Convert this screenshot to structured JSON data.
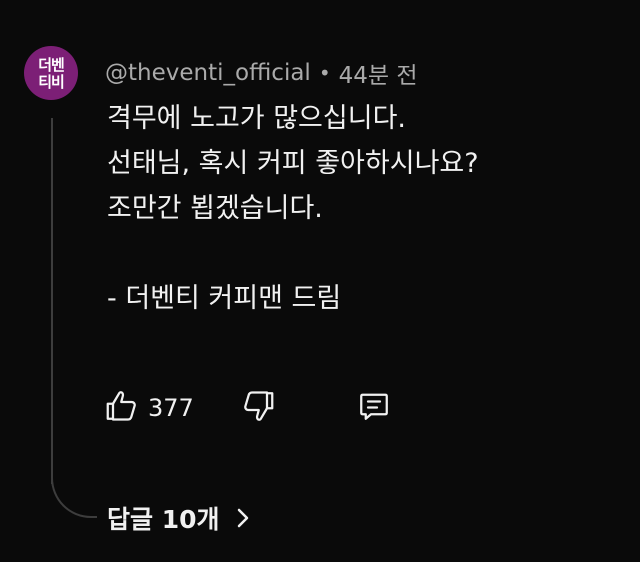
{
  "avatar": {
    "line1": "더벤",
    "line2": "티비",
    "bg_color": "#7c1f76"
  },
  "comment": {
    "username": "@theventi_official",
    "separator": "•",
    "time_ago": "44분 전",
    "lines": [
      "격무에 노고가 많으십니다.",
      "선태님, 혹시 커피 좋아하시나요?",
      "조만간 뵙겠습니다.",
      "",
      "- 더벤티 커피맨 드림"
    ]
  },
  "actions": {
    "like_icon": "thumbs-up-icon",
    "like_count": "377",
    "dislike_icon": "thumbs-down-icon",
    "reply_icon": "comment-reply-icon"
  },
  "replies": {
    "label": "답글 10개",
    "icon": "chevron-right-icon"
  },
  "colors": {
    "background": "#0a0a0a",
    "text": "#f1f1f1",
    "meta_text": "#aaaaaa",
    "thread_line": "#3d3d3d"
  }
}
